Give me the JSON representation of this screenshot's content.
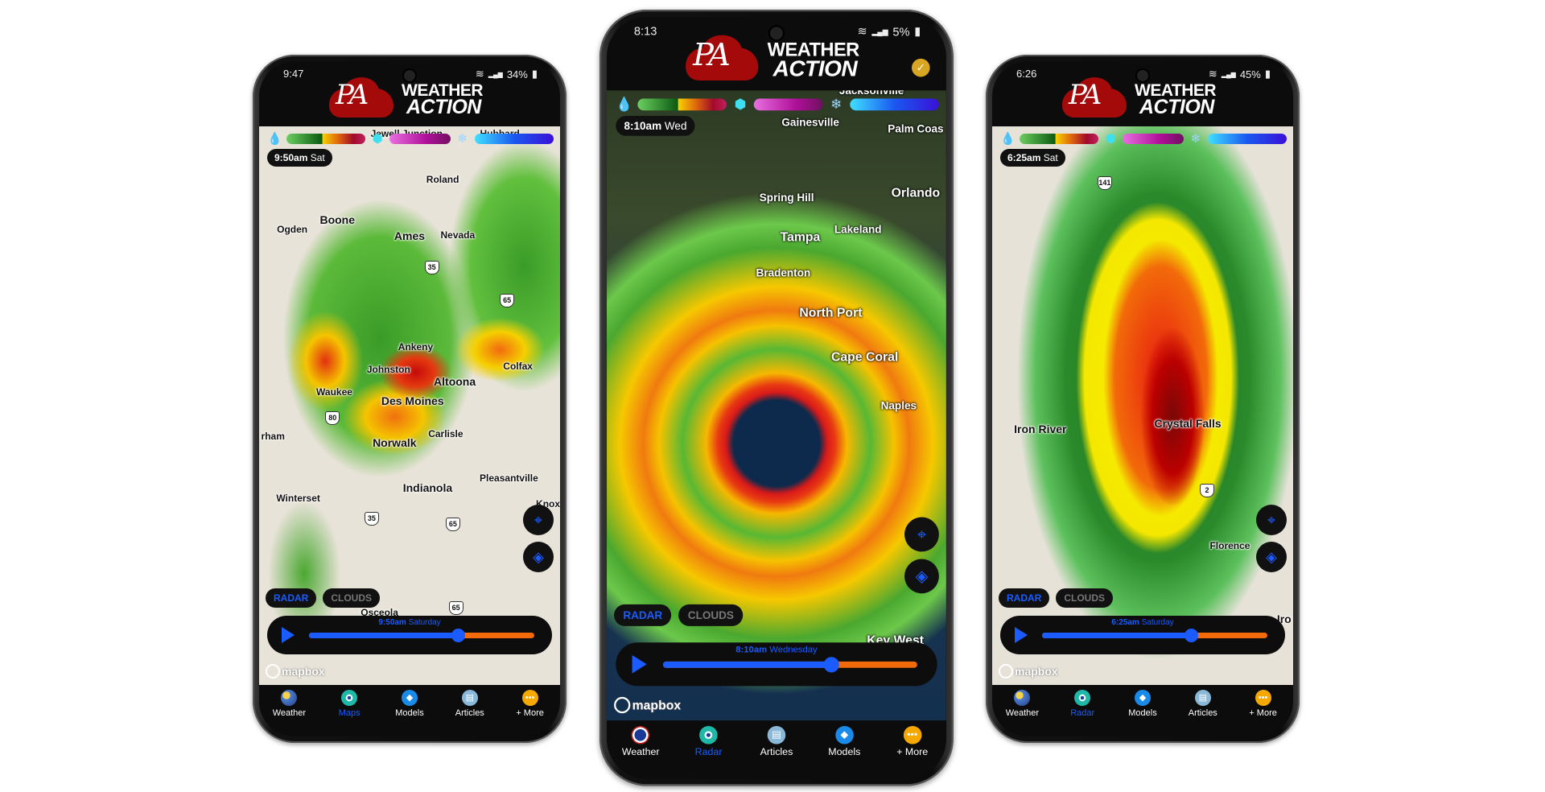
{
  "phones": [
    {
      "status": {
        "time": "9:47",
        "battery": "34%"
      },
      "app": {
        "logo_mark": "PA",
        "logo_line1": "WEATHER",
        "logo_line2": "ACTION"
      },
      "legend": {
        "icons": [
          "rain-drop-icon",
          "ice-cube-icon",
          "snowflake-icon"
        ]
      },
      "time_chip": {
        "time": "9:50am",
        "day": "Sat"
      },
      "cities": [
        "Jewell Junction",
        "Hubbard",
        "Roland",
        "Boone",
        "Ogden",
        "Ames",
        "Nevada",
        "Ankeny",
        "Johnston",
        "Altoona",
        "Colfax",
        "Waukee",
        "Des Moines",
        "Carlisle",
        "Norwalk",
        "Indianola",
        "Pleasantville",
        "Winterset",
        "Knox",
        "rham",
        "Osceola"
      ],
      "shields": [
        "35",
        "65",
        "80",
        "35",
        "65",
        "65",
        "65"
      ],
      "layers": [
        {
          "label": "RADAR",
          "active": true
        },
        {
          "label": "CLOUDS",
          "active": false
        }
      ],
      "timeline": {
        "time": "9:50am",
        "day": "Saturday",
        "progress": 0.66
      },
      "attribution": "mapbox",
      "nav": [
        {
          "label": "Weather",
          "icon": "weather-icon",
          "active": false
        },
        {
          "label": "Maps",
          "icon": "radar-icon",
          "active": true
        },
        {
          "label": "Models",
          "icon": "diamond-icon",
          "active": false
        },
        {
          "label": "Articles",
          "icon": "articles-icon",
          "active": false
        },
        {
          "label": "+ More",
          "icon": "more-icon",
          "active": false
        }
      ]
    },
    {
      "status": {
        "time": "8:13",
        "battery": "5%"
      },
      "app": {
        "logo_mark": "PA",
        "logo_line1": "WEATHER",
        "logo_line2": "ACTION",
        "badge": "✓"
      },
      "legend": {
        "icons": [
          "rain-drop-icon",
          "ice-cube-icon",
          "snowflake-icon"
        ]
      },
      "time_chip": {
        "time": "8:10am",
        "day": "Wed"
      },
      "cities": [
        "Jacksonville",
        "Gainesville",
        "Palm Coas",
        "Spring Hill",
        "Orlando",
        "Tampa",
        "Lakeland",
        "Bradenton",
        "North Port",
        "Cape Coral",
        "Naples",
        "Key West"
      ],
      "shields": [],
      "layers": [
        {
          "label": "RADAR",
          "active": true
        },
        {
          "label": "CLOUDS",
          "active": false
        }
      ],
      "timeline": {
        "time": "8:10am",
        "day": "Wednesday",
        "progress": 0.66
      },
      "attribution": "mapbox",
      "nav": [
        {
          "label": "Weather",
          "icon": "nws-icon",
          "active": false
        },
        {
          "label": "Radar",
          "icon": "radar-icon",
          "active": true
        },
        {
          "label": "Articles",
          "icon": "articles-icon",
          "active": false
        },
        {
          "label": "Models",
          "icon": "diamond-icon",
          "active": false
        },
        {
          "label": "+ More",
          "icon": "more-icon",
          "active": false
        }
      ]
    },
    {
      "status": {
        "time": "6:26",
        "battery": "45%"
      },
      "app": {
        "logo_mark": "PA",
        "logo_line1": "WEATHER",
        "logo_line2": "ACTION"
      },
      "legend": {
        "icons": [
          "rain-drop-icon",
          "ice-cube-icon",
          "snowflake-icon"
        ]
      },
      "time_chip": {
        "time": "6:25am",
        "day": "Sat"
      },
      "cities": [
        "Iron River",
        "Crystal Falls",
        "Florence",
        "Iro"
      ],
      "shields": [
        "141",
        "2"
      ],
      "layers": [
        {
          "label": "RADAR",
          "active": true
        },
        {
          "label": "CLOUDS",
          "active": false
        }
      ],
      "timeline": {
        "time": "6:25am",
        "day": "Saturday",
        "progress": 0.66
      },
      "attribution": "mapbox",
      "nav": [
        {
          "label": "Weather",
          "icon": "weather-icon",
          "active": false
        },
        {
          "label": "Radar",
          "icon": "radar-icon",
          "active": true
        },
        {
          "label": "Models",
          "icon": "diamond-icon",
          "active": false
        },
        {
          "label": "Articles",
          "icon": "articles-icon",
          "active": false
        },
        {
          "label": "+ More",
          "icon": "more-icon",
          "active": false
        }
      ]
    }
  ],
  "colors": {
    "accent": "#1a5cff",
    "timeline_future": "#f26a0a",
    "brand_red": "#a50a0a"
  }
}
